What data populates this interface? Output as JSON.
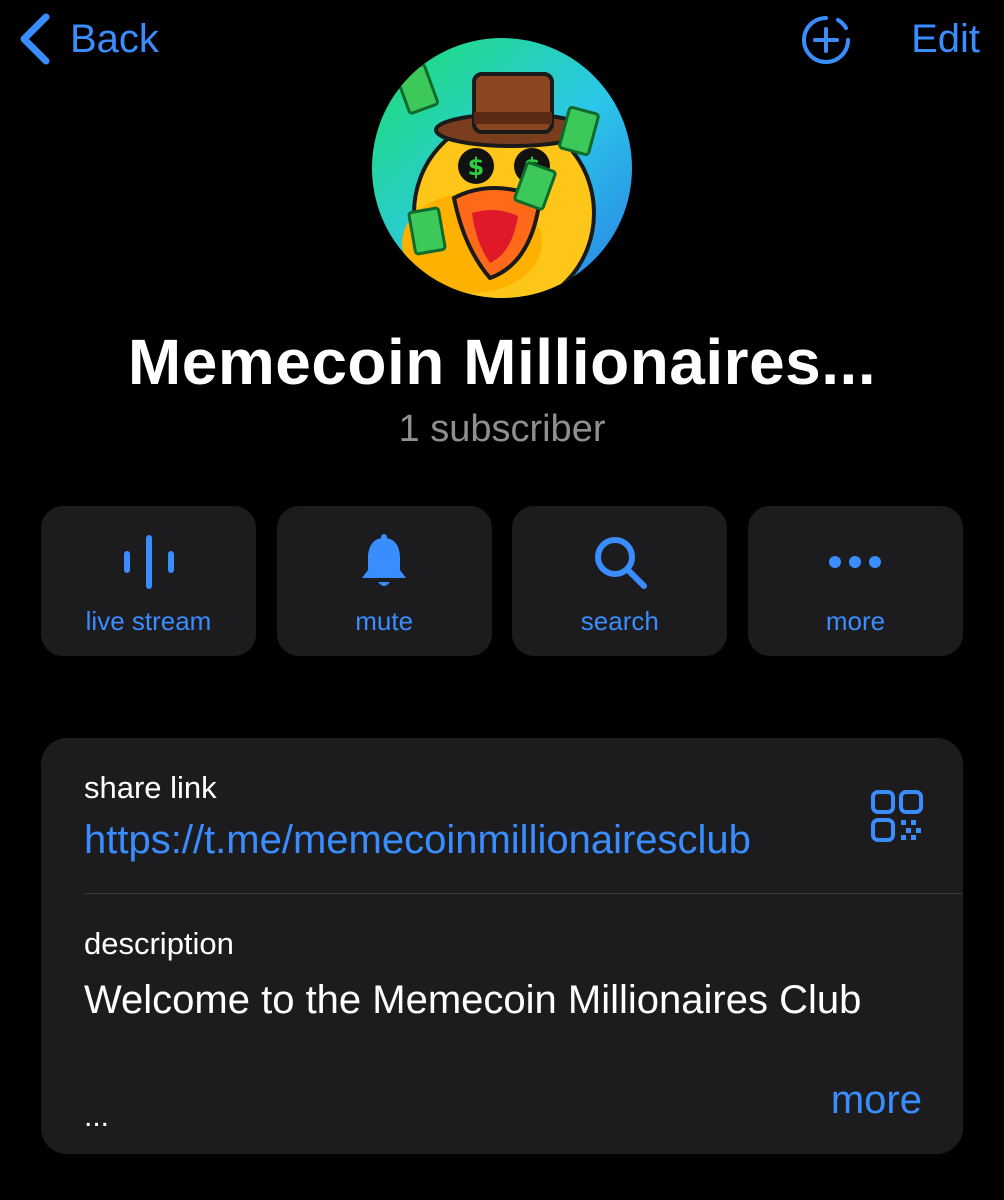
{
  "nav": {
    "back_label": "Back",
    "edit_label": "Edit"
  },
  "channel": {
    "title": "Memecoin Millionaires...",
    "subscribers": "1 subscriber"
  },
  "actions": [
    {
      "label": "live stream",
      "icon": "live-stream-icon"
    },
    {
      "label": "mute",
      "icon": "bell-icon"
    },
    {
      "label": "search",
      "icon": "search-icon"
    },
    {
      "label": "more",
      "icon": "more-dots-icon"
    }
  ],
  "info": {
    "share_label": "share link",
    "share_url": "https://t.me/memecoinmillionairesclub",
    "description_label": "description",
    "description_text": "Welcome to the Memecoin Millionaires Club",
    "ellipsis": "...",
    "more_label": "more"
  },
  "colors": {
    "accent": "#3a8dff",
    "background": "#000000",
    "card": "#1c1c1e",
    "secondary_text": "#8e8e93"
  }
}
